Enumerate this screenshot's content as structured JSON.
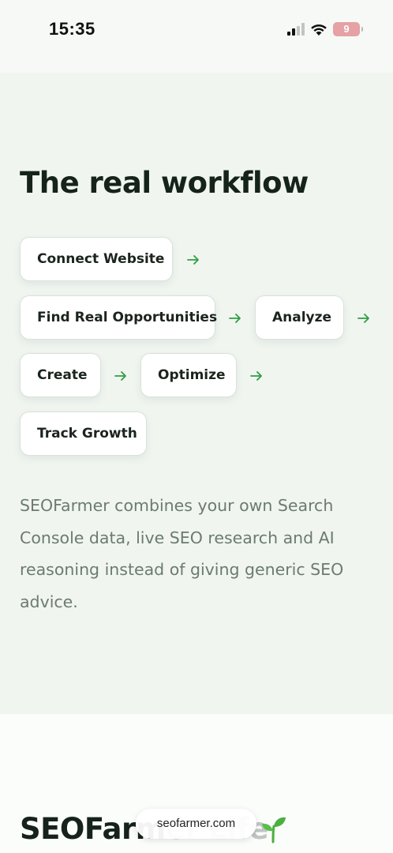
{
  "status_bar": {
    "time": "15:35",
    "battery_level": "9"
  },
  "workflow": {
    "title": "The real workflow",
    "steps": [
      {
        "label": "Connect Website"
      },
      {
        "label": "Find Real Opportunities"
      },
      {
        "label": "Analyze"
      },
      {
        "label": "Create"
      },
      {
        "label": "Optimize"
      },
      {
        "label": "Track Growth"
      }
    ],
    "description": "SEOFarmer combines your own Search Console data, live SEO research and AI reasoning instead of giving generic SEO advice."
  },
  "next_section": {
    "title_visible": "SEOFarm",
    "title_faded": "er Life"
  },
  "browser": {
    "url": "seofarmer.com"
  },
  "colors": {
    "accent_arrow": "#2f9e44",
    "sprout": "#4caf3f"
  }
}
